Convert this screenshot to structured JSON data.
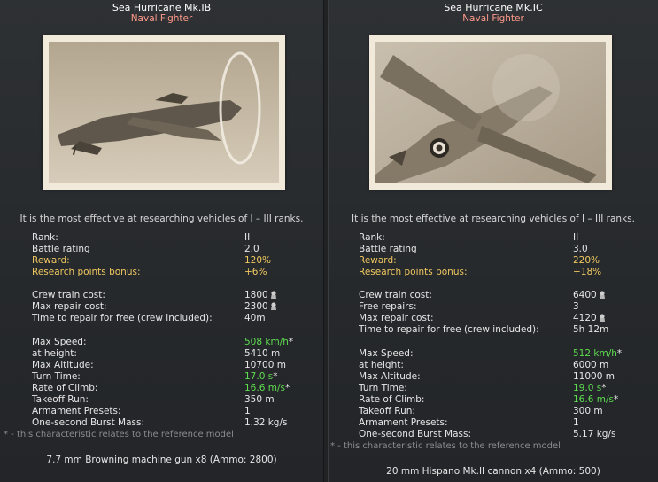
{
  "research_note": "It is the most effective at researching vehicles of I – III ranks.",
  "footnote": "* - this characteristic relates to the reference model",
  "panels": [
    {
      "title": "Sea Hurricane Mk.IB",
      "subtitle": "Naval Fighter",
      "photo_icon": "aircraft-photo",
      "stats": {
        "rank_label": "Rank:",
        "rank": "II",
        "br_label": "Battle rating",
        "br": "2.0",
        "reward_label": "Reward:",
        "reward": "120%",
        "rp_label": "Research points bonus:",
        "rp": "+6%",
        "crew_label": "Crew train cost:",
        "crew": "1800",
        "second_label": "Max repair cost:",
        "second": "2300",
        "third_label": "Time to repair for free (crew included):",
        "third": "40m",
        "speed_label": "Max Speed:",
        "speed": "508 km/h",
        "height_label": "at height:",
        "height": "5410 m",
        "alt_label": "Max Altitude:",
        "alt": "10700 m",
        "turn_label": "Turn Time:",
        "turn": "17.0 s",
        "climb_label": "Rate of Climb:",
        "climb": "16.6 m/s",
        "takeoff_label": "Takeoff Run:",
        "takeoff": "350 m",
        "presets_label": "Armament Presets:",
        "presets": "1",
        "burst_label": "One-second Burst Mass:",
        "burst": "1.32 kg/s",
        "star": "*"
      },
      "armament": "7.7 mm Browning machine gun x8 (Ammo: 2800)"
    },
    {
      "title": "Sea Hurricane Mk.IC",
      "subtitle": "Naval Fighter",
      "photo_icon": "aircraft-photo",
      "stats": {
        "rank_label": "Rank:",
        "rank": "II",
        "br_label": "Battle rating",
        "br": "3.0",
        "reward_label": "Reward:",
        "reward": "220%",
        "rp_label": "Research points bonus:",
        "rp": "+18%",
        "crew_label": "Crew train cost:",
        "crew": "6400",
        "second_label": "Free repairs:",
        "second": "3",
        "third_label": "Max repair cost:",
        "third": "4120",
        "fourth_label": "Time to repair for free (crew included):",
        "fourth": "5h 12m",
        "speed_label": "Max Speed:",
        "speed": "512 km/h",
        "height_label": "at height:",
        "height": "6000 m",
        "alt_label": "Max Altitude:",
        "alt": "11000 m",
        "turn_label": "Turn Time:",
        "turn": "19.0 s",
        "climb_label": "Rate of Climb:",
        "climb": "16.6 m/s",
        "takeoff_label": "Takeoff Run:",
        "takeoff": "300 m",
        "presets_label": "Armament Presets:",
        "presets": "1",
        "burst_label": "One-second Burst Mass:",
        "burst": "5.17 kg/s",
        "star": "*"
      },
      "armament": "20 mm Hispano Mk.II cannon x4 (Ammo: 500)"
    }
  ],
  "colors": {
    "gold": "#f0c860",
    "green": "#5ddc4f",
    "subtitle": "#ff9a8a"
  },
  "icons": {
    "silver_lions": "lion-icon"
  }
}
